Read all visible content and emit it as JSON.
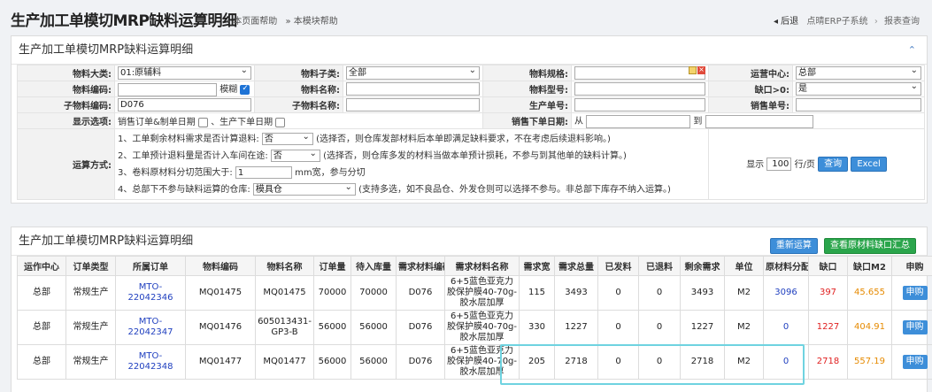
{
  "header": {
    "title": "生产加工单模切MRP缺料运算明细",
    "help_page": "» 本页面帮助",
    "help_module": "» 本模块帮助",
    "back": "◂ 后退",
    "system": "点晴ERP子系统",
    "sep": "›",
    "current": "报表查询"
  },
  "query": {
    "title": "生产加工单模切MRP缺料运算明细",
    "collapse_icon": "chevron-up-icon",
    "material_class_label": "物料大类:",
    "material_class_value": "01:原辅料",
    "material_subclass_label": "物料子类:",
    "material_subclass_value": "全部",
    "material_spec_label": "物料规格:",
    "material_spec_value": "",
    "ops_center_label": "运营中心:",
    "ops_center_value": "总部",
    "material_code_label": "物料编码:",
    "material_code_value": "",
    "fuzzy_label": "模糊",
    "material_name_label": "物料名称:",
    "material_name_value": "",
    "material_model_label": "物料型号:",
    "material_model_value": "",
    "shortage_label": "缺口>0:",
    "shortage_value": "是",
    "sub_code_label": "子物料编码:",
    "sub_code_value": "D076",
    "sub_name_label": "子物料名称:",
    "sub_name_value": "",
    "prod_no_label": "生产单号:",
    "prod_no_value": "",
    "sales_no_label": "销售单号:",
    "sales_no_value": "",
    "display_label": "显示选项:",
    "display_opt1": "销售订单&制单日期",
    "display_opt2": "、生产下单日期",
    "sales_date_label": "销售下单日期:",
    "date_from": "从",
    "date_to": "到",
    "calc_label": "运算方式:",
    "line1_a": "1、工单剩余材料需求是否计算退料:",
    "line1_sel": "否",
    "line1_b": "(选择否，则仓库发部材料后本单即满足缺料要求，不在考虑后续退料影响。)",
    "line2_a": "2、工单预计退料量是否计入车间在途:",
    "line2_sel": "否",
    "line2_b": "(选择否，则仓库多发的材料当做本单预计损耗，不参与到其他单的缺料计算。)",
    "line3_a": "3、卷料原材料分切范围大于:",
    "line3_val": "1",
    "line3_b": "mm宽，参与分切",
    "line4_a": "4、总部下不参与缺料运算的仓库:",
    "line4_sel": "模具仓",
    "line4_b": "(支持多选，如不良品仓、外发仓则可以选择不参与。非总部下库存不纳入运算。)",
    "show_label": "显示",
    "page_size": "100",
    "per_page": "行/页",
    "search_btn": "查询",
    "excel_btn": "Excel"
  },
  "result": {
    "title": "生产加工单模切MRP缺料运算明细",
    "recalc_btn": "重新运算",
    "summary_btn": "查看原材料缺口汇总",
    "columns": [
      "运作中心",
      "订单类型",
      "所属订单",
      "物料编码",
      "物料名称",
      "订单量",
      "待入库量",
      "需求材料编码",
      "需求材料名称",
      "需求宽",
      "需求总量",
      "已发料",
      "已退料",
      "剩余需求",
      "单位",
      "原材料分配",
      "缺口",
      "缺口M2",
      "申购"
    ],
    "rows": [
      {
        "center": "总部",
        "type": "常规生产",
        "order": "MTO-22042346",
        "code": "MQ01475",
        "name": "MQ01475",
        "qty": "70000",
        "pending": "70000",
        "mat_code": "D076",
        "mat_name": "6+5蓝色亚克力胶保护膜40-70g-胶水层加厚",
        "width": "115",
        "total": "3493",
        "issued": "0",
        "returned": "0",
        "remain": "3493",
        "unit": "M2",
        "alloc": "3096",
        "gap": "397",
        "gap_m2": "45.655",
        "apply": "申购"
      },
      {
        "center": "总部",
        "type": "常规生产",
        "order": "MTO-22042347",
        "code": "MQ01476",
        "name": "605013431-GP3-B",
        "qty": "56000",
        "pending": "56000",
        "mat_code": "D076",
        "mat_name": "6+5蓝色亚克力胶保护膜40-70g-胶水层加厚",
        "width": "330",
        "total": "1227",
        "issued": "0",
        "returned": "0",
        "remain": "1227",
        "unit": "M2",
        "alloc": "0",
        "gap": "1227",
        "gap_m2": "404.91",
        "apply": "申购"
      },
      {
        "center": "总部",
        "type": "常规生产",
        "order": "MTO-22042348",
        "code": "MQ01477",
        "name": "MQ01477",
        "qty": "56000",
        "pending": "56000",
        "mat_code": "D076",
        "mat_name": "6+5蓝色亚克力胶保护膜40-70g-胶水层加厚",
        "width": "205",
        "total": "2718",
        "issued": "0",
        "returned": "0",
        "remain": "2718",
        "unit": "M2",
        "alloc": "0",
        "gap": "2718",
        "gap_m2": "557.19",
        "apply": "申购"
      }
    ]
  }
}
